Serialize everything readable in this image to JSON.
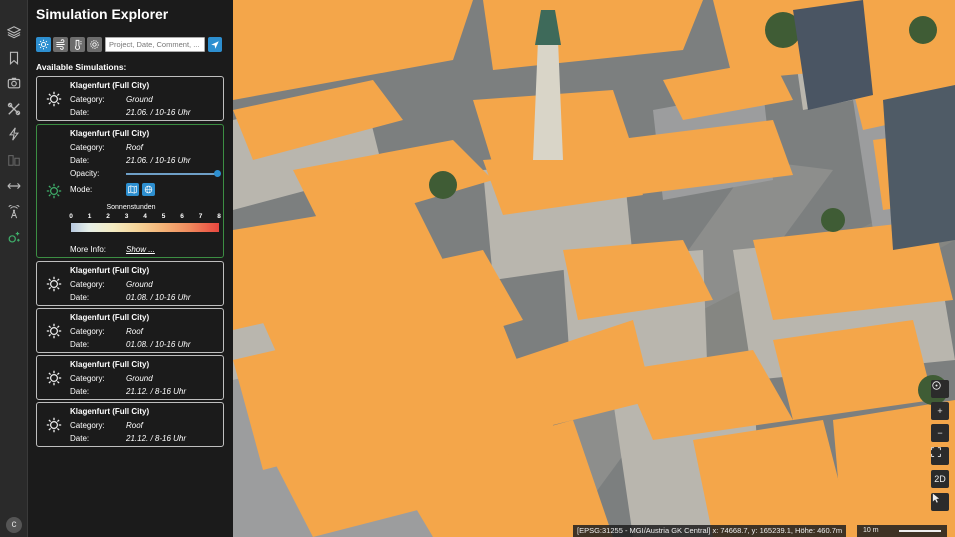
{
  "app": {
    "title": "Simulation Explorer"
  },
  "rail": {
    "icons": [
      "layers-icon",
      "bookmark-icon",
      "camera-icon",
      "tools-icon",
      "energy-icon",
      "buildings-icon",
      "measure-icon",
      "sensor-icon",
      "simulation-icon"
    ],
    "avatar": "c"
  },
  "toolbar": {
    "search_placeholder": "Project, Date, Comment, ...",
    "active_color": "#2d8fd0"
  },
  "list": {
    "heading": "Available Simulations:",
    "category_label": "Category:",
    "date_label": "Date:",
    "opacity_label": "Opacity:",
    "mode_label": "Mode:",
    "legend_title": "Sonnenstunden",
    "legend_ticks": [
      "0",
      "1",
      "2",
      "3",
      "4",
      "5",
      "6",
      "7",
      "8"
    ],
    "more_label": "More Info:",
    "more_link": "Show ...",
    "opacity_value": 1.0,
    "items": [
      {
        "name": "Klagenfurt (Full City)",
        "category": "Ground",
        "date": "21.06. / 10-16 Uhr"
      },
      {
        "name": "Klagenfurt (Full City)",
        "category": "Roof",
        "date": "21.06. / 10-16 Uhr"
      },
      {
        "name": "Klagenfurt (Full City)",
        "category": "Ground",
        "date": "01.08. / 10-16 Uhr"
      },
      {
        "name": "Klagenfurt (Full City)",
        "category": "Roof",
        "date": "01.08. / 10-16 Uhr"
      },
      {
        "name": "Klagenfurt (Full City)",
        "category": "Ground",
        "date": "21.12. / 8-16 Uhr"
      },
      {
        "name": "Klagenfurt (Full City)",
        "category": "Roof",
        "date": "21.12. / 8-16 Uhr"
      }
    ]
  },
  "map": {
    "coords": "[EPSG:31255 - MGI/Austria GK Central] x: 74668.7, y: 165239.1, Höhe: 460.7m",
    "scale_label": "10 m",
    "controls": {
      "compass": "compass-icon",
      "zoom_in": "+",
      "zoom_out": "−",
      "fullscreen": "fullscreen-icon",
      "view_mode": "2D",
      "pointer": "pointer-icon"
    },
    "roof_color": "#f4a64a"
  }
}
